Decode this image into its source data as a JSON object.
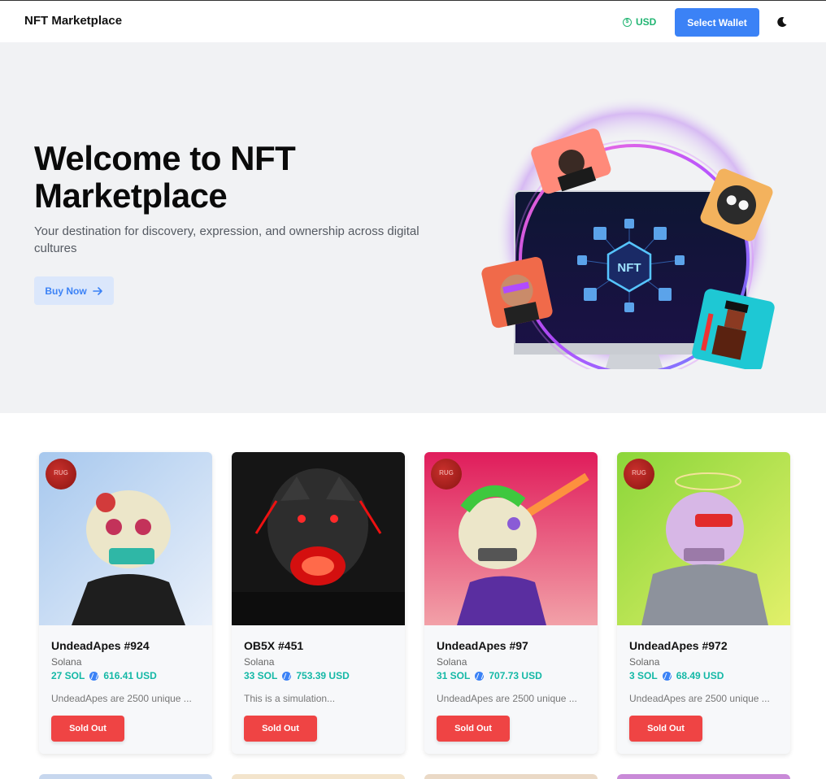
{
  "header": {
    "brand": "NFT Marketplace",
    "currency": "USD",
    "currency_icon": "dollar-coin-icon",
    "wallet_button": "Select Wallet",
    "theme_icon": "moon-icon"
  },
  "hero": {
    "title": "Welcome to NFT Marketplace",
    "subtitle": "Your destination for discovery, expression, and ownership across digital cultures",
    "buy_button": "Buy Now",
    "buy_icon": "arrow-right-icon",
    "art_label": "NFT"
  },
  "cards": [
    {
      "name": "UndeadApes #924",
      "chain": "Solana",
      "sol": "27 SOL",
      "usd": "616.41 USD",
      "desc": "UndeadApes are 2500 unique ...",
      "button": "Sold Out",
      "badge": "RUG"
    },
    {
      "name": "OB5X #451",
      "chain": "Solana",
      "sol": "33 SOL",
      "usd": "753.39 USD",
      "desc": "This is a simulation...",
      "button": "Sold Out",
      "badge": ""
    },
    {
      "name": "UndeadApes #97",
      "chain": "Solana",
      "sol": "31 SOL",
      "usd": "707.73 USD",
      "desc": "UndeadApes are 2500 unique ...",
      "button": "Sold Out",
      "badge": "RUG"
    },
    {
      "name": "UndeadApes #972",
      "chain": "Solana",
      "sol": "3 SOL",
      "usd": "68.49 USD",
      "desc": "UndeadApes are 2500 unique ...",
      "button": "Sold Out",
      "badge": "RUG"
    }
  ],
  "colors": {
    "accent": "#3b82f6",
    "price": "#14b8a6",
    "sold": "#ef4444",
    "currency": "#22b573"
  }
}
